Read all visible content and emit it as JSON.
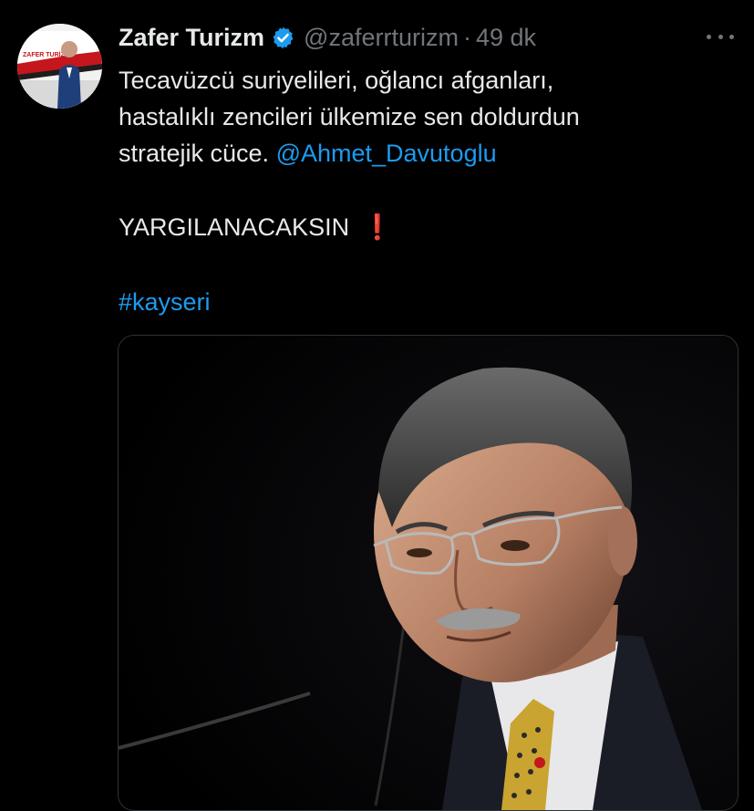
{
  "tweet": {
    "display_name": "Zafer Turizm",
    "verified_icon": "verified-badge-icon",
    "handle": "@zaferrturizm",
    "separator": "·",
    "time": "49 dk",
    "more_icon": "more-options-icon",
    "text_line1": "Tecavüzcü suriyelileri, oğlancı afganları,",
    "text_line2": "hastalıklı zencileri ülkemize sen doldurdun",
    "text_line3_prefix": "stratejik cüce. ",
    "mention": "@Ahmet_Davutoglu",
    "shout": "YARGILANACAKSIN",
    "shout_emoji": "❗",
    "hashtag": "#kayseri",
    "avatar_text": "ZAFER TURİZM"
  },
  "colors": {
    "background": "#000000",
    "text": "#e7e9ea",
    "secondary": "#71767b",
    "link": "#1d9bf0",
    "verified": "#1d9bf0",
    "exclaim": "#e0212b"
  }
}
